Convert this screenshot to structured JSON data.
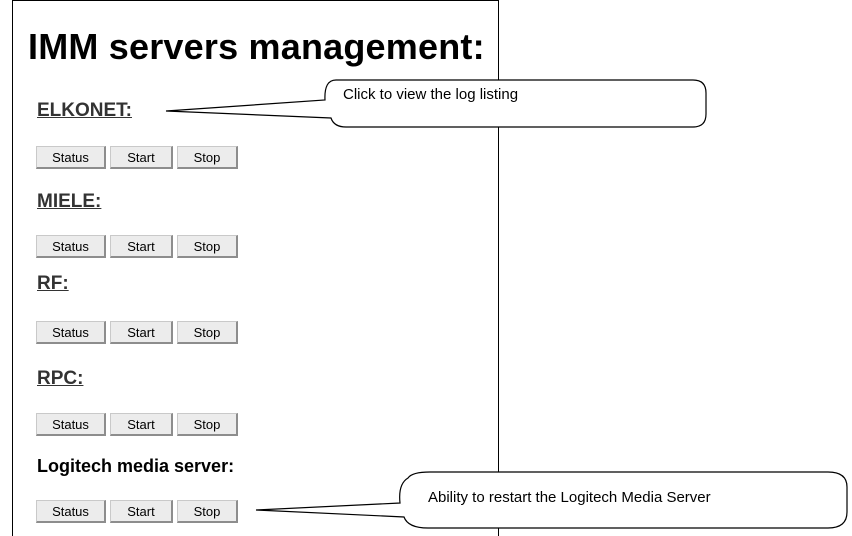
{
  "page": {
    "title": "IMM servers management:"
  },
  "buttons": {
    "status": "Status",
    "start": "Start",
    "stop": "Stop"
  },
  "servers": [
    {
      "name": "ELKONET:",
      "linked": true
    },
    {
      "name": "MIELE:",
      "linked": true
    },
    {
      "name": "RF:",
      "linked": true
    },
    {
      "name": "RPC:",
      "linked": true
    },
    {
      "name": "Logitech media server:",
      "linked": false
    }
  ],
  "callouts": {
    "log_listing": "Click to view the log listing",
    "restart_lms": "Ability to restart the Logitech Media Server"
  }
}
